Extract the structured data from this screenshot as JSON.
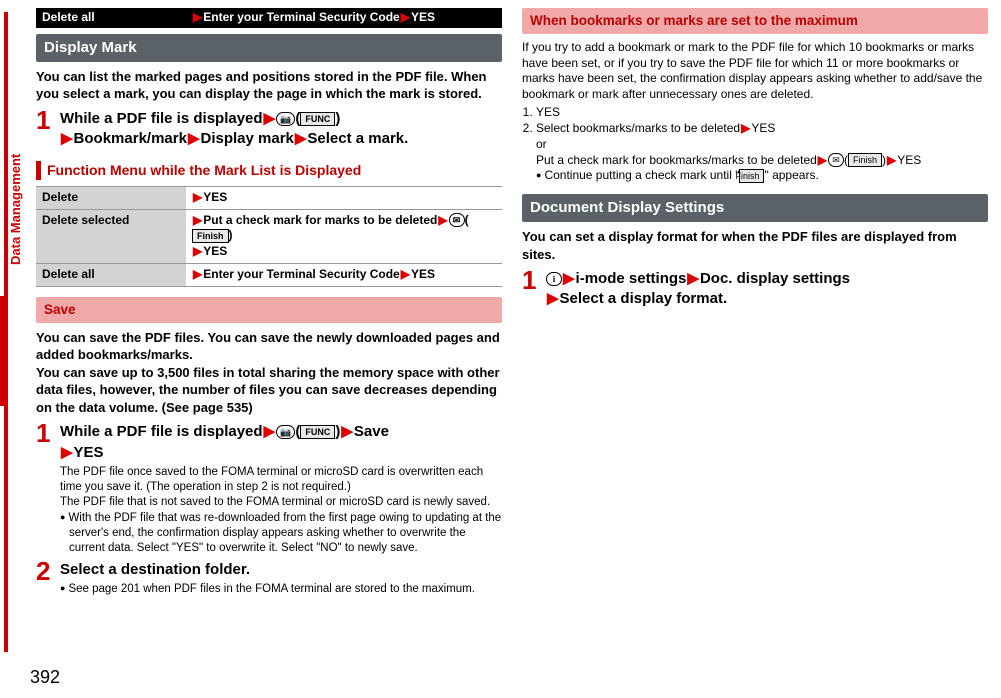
{
  "sideTab": "Data Management",
  "pageNumber": "392",
  "topBar": {
    "label": "Delete all",
    "value_pre": "Enter your Terminal Security Code",
    "value_post": "YES"
  },
  "displayMark": {
    "heading": "Display Mark",
    "body": "You can list the marked pages and positions stored in the PDF file. When you select a mark, you can display the page in which the mark is stored.",
    "step1_pre": "While a PDF file is displayed",
    "icon_alpha": "📷",
    "icon_func": "FUNC",
    "step1_b": "Bookmark/mark",
    "step1_c": "Display mark",
    "step1_d": "Select a mark."
  },
  "funcMenu": {
    "heading": "Function Menu while the Mark List is Displayed",
    "rows": [
      {
        "label": "Delete",
        "val_a": "YES"
      },
      {
        "label": "Delete selected",
        "val_a": "Put a check mark for marks to be deleted",
        "icon_mail": "✉",
        "icon_finish": "Finish",
        "val_b": "YES"
      },
      {
        "label": "Delete all",
        "val_a": "Enter your Terminal Security Code",
        "val_b": "YES"
      }
    ]
  },
  "save": {
    "heading": "Save",
    "body": "You can save the PDF files. You can save the newly downloaded pages and added bookmarks/marks.\nYou can save up to 3,500 files in total sharing the memory space with other data files, however, the number of files you can save decreases depending on the data volume. (See page 535)",
    "step1_pre": "While a PDF file is displayed",
    "icon_alpha": "📷",
    "icon_func": "FUNC",
    "step1_b": "Save",
    "step1_c": "YES",
    "step1_desc1": "The PDF file once saved to the FOMA terminal or microSD card is overwritten each time you save it. (The operation in step 2 is not required.)",
    "step1_desc2": "The PDF file that is not saved to the FOMA terminal or microSD card is newly saved.",
    "step1_bullet": "With the PDF file that was re-downloaded from the first page owing to updating at the server's end, the confirmation display appears asking whether to overwrite the current data. Select \"YES\" to overwrite it. Select \"NO\" to newly save.",
    "step2_title": "Select a destination folder.",
    "step2_bullet": "See page 201 when PDF files in the FOMA terminal are stored to the maximum."
  },
  "maximum": {
    "heading": "When bookmarks or marks are set to the maximum",
    "body": "If you try to add a bookmark or mark to the PDF file for which 10 bookmarks or marks have been set, or if you try to save the PDF file for which 11 or more bookmarks or marks have been set, the confirmation display appears asking whether to add/save the bookmark or mark after unnecessary ones are deleted.",
    "li1": "YES",
    "li2": "Select bookmarks/marks to be deleted",
    "li2_yes": "YES",
    "li2_or": "or",
    "li2_alt": "Put a check mark for bookmarks/marks to be deleted",
    "icon_mail": "✉",
    "icon_finish": "Finish",
    "li2_alt_yes": "YES",
    "li2_bullet_a": "Continue putting a check mark until \"",
    "li2_bullet_b": "\" appears."
  },
  "docDisplay": {
    "heading": "Document Display Settings",
    "body": "You can set a display format for when the PDF files are displayed from sites.",
    "icon_i": "i",
    "step1_a": "i-mode settings",
    "step1_b": "Doc. display settings",
    "step1_c": "Select a display format."
  }
}
